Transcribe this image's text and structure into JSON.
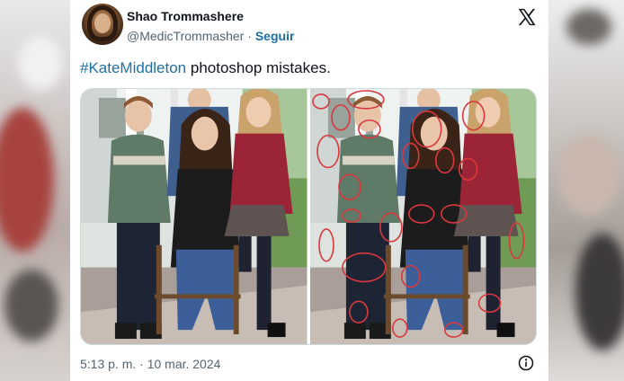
{
  "tweet": {
    "author_name": "Shao Trommashere",
    "author_handle": "@MedicTrommasher",
    "separator": "·",
    "follow_label": "Seguir",
    "hashtag": "#KateMiddleton",
    "text": " photoshop mistakes.",
    "timestamp": "5:13 p. m. · 10 mar. 2024",
    "brand_icon": "x-logo-icon",
    "info_icon": "info-icon"
  },
  "media": {
    "images": [
      {
        "description_name": "original-photo"
      },
      {
        "description_name": "annotated-photo-with-red-circles"
      }
    ],
    "annotation_color": "#d9383f"
  },
  "colors": {
    "link": "#1d6fa5",
    "text": "#0f1419",
    "muted": "#536471"
  }
}
